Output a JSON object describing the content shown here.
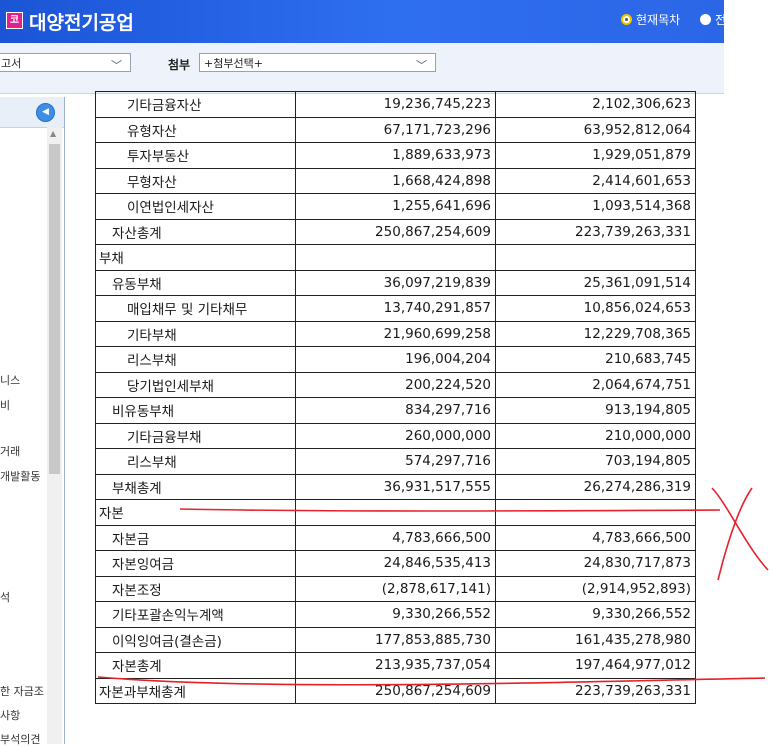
{
  "header": {
    "logo_char": "코",
    "company": "대양전기공업",
    "toc_radio": "현재목차",
    "all_radio": "전"
  },
  "toolbar": {
    "report_select": "고서",
    "attach_label": "첨부",
    "attach_select": "+첨부선택+"
  },
  "sidebar": {
    "items": [
      "니스",
      "비",
      "거래",
      "개발활동",
      "석",
      "한 자금조",
      "사항",
      "부석의견"
    ]
  },
  "table": {
    "rows": [
      {
        "label": "기타금융자산",
        "level": 2,
        "current": "19,236,745,223",
        "prior": "2,102,306,623"
      },
      {
        "label": "유형자산",
        "level": 2,
        "current": "67,171,723,296",
        "prior": "63,952,812,064"
      },
      {
        "label": "투자부동산",
        "level": 2,
        "current": "1,889,633,973",
        "prior": "1,929,051,879"
      },
      {
        "label": "무형자산",
        "level": 2,
        "current": "1,668,424,898",
        "prior": "2,414,601,653"
      },
      {
        "label": "이연법인세자산",
        "level": 2,
        "current": "1,255,641,696",
        "prior": "1,093,514,368"
      },
      {
        "label": "자산총계",
        "level": 1,
        "current": "250,867,254,609",
        "prior": "223,739,263,331"
      },
      {
        "label": "부채",
        "level": 0,
        "current": "",
        "prior": ""
      },
      {
        "label": "유동부채",
        "level": 1,
        "current": "36,097,219,839",
        "prior": "25,361,091,514"
      },
      {
        "label": "매입채무 및 기타채무",
        "level": 2,
        "current": "13,740,291,857",
        "prior": "10,856,024,653"
      },
      {
        "label": "기타부채",
        "level": 2,
        "current": "21,960,699,258",
        "prior": "12,229,708,365"
      },
      {
        "label": "리스부채",
        "level": 2,
        "current": "196,004,204",
        "prior": "210,683,745"
      },
      {
        "label": "당기법인세부채",
        "level": 2,
        "current": "200,224,520",
        "prior": "2,064,674,751"
      },
      {
        "label": "비유동부채",
        "level": 1,
        "current": "834,297,716",
        "prior": "913,194,805"
      },
      {
        "label": "기타금융부채",
        "level": 2,
        "current": "260,000,000",
        "prior": "210,000,000"
      },
      {
        "label": "리스부채",
        "level": 2,
        "current": "574,297,716",
        "prior": "703,194,805"
      },
      {
        "label": "부채총계",
        "level": 1,
        "current": "36,931,517,555",
        "prior": "26,274,286,319"
      },
      {
        "label": "자본",
        "level": 0,
        "current": "",
        "prior": ""
      },
      {
        "label": "자본금",
        "level": 1,
        "current": "4,783,666,500",
        "prior": "4,783,666,500"
      },
      {
        "label": "자본잉여금",
        "level": 1,
        "current": "24,846,535,413",
        "prior": "24,830,717,873"
      },
      {
        "label": "자본조정",
        "level": 1,
        "current": "(2,878,617,141)",
        "prior": "(2,914,952,893)"
      },
      {
        "label": "기타포괄손익누계액",
        "level": 1,
        "current": "9,330,266,552",
        "prior": "9,330,266,552"
      },
      {
        "label": "이익잉여금(결손금)",
        "level": 1,
        "current": "177,853,885,730",
        "prior": "161,435,278,980"
      },
      {
        "label": "자본총계",
        "level": 1,
        "current": "213,935,737,054",
        "prior": "197,464,977,012"
      },
      {
        "label": "자본과부채총계",
        "level": 0,
        "current": "250,867,254,609",
        "prior": "223,739,263,331"
      }
    ]
  },
  "colors": {
    "header_blue": "#2e6ff0",
    "annotation_red": "#e8202a"
  }
}
